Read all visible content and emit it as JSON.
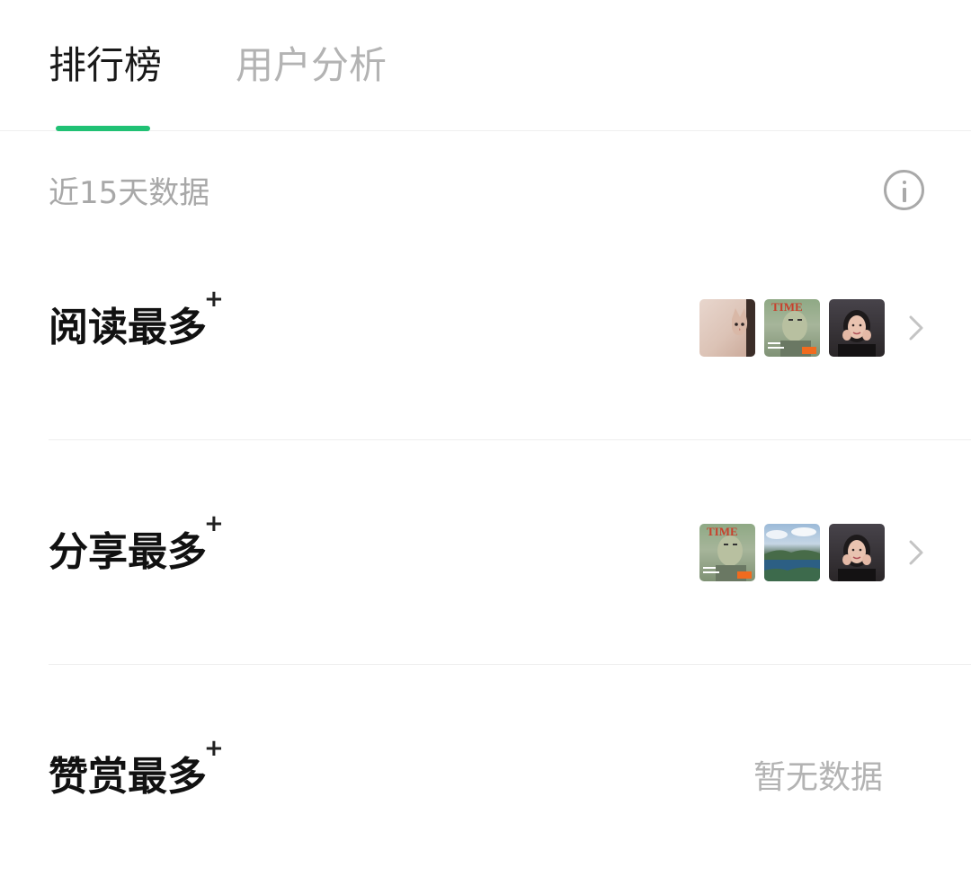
{
  "tabs": [
    {
      "label": "排行榜",
      "active": true
    },
    {
      "label": "用户分析",
      "active": false
    }
  ],
  "accent_color": "#20c174",
  "period_label": "近15天数据",
  "info_icon": "info-circle-icon",
  "rows": [
    {
      "title": "阅读最多",
      "superscript": "+",
      "thumbnails": [
        "cat-photo",
        "time-magazine-cover",
        "woman-portrait"
      ],
      "chevron_icon": "chevron-right-icon"
    },
    {
      "title": "分享最多",
      "superscript": "+",
      "thumbnails": [
        "time-magazine-cover",
        "lake-landscape",
        "woman-portrait"
      ],
      "chevron_icon": "chevron-right-icon"
    },
    {
      "title": "赞赏最多",
      "superscript": "+",
      "empty_text": "暂无数据"
    }
  ]
}
